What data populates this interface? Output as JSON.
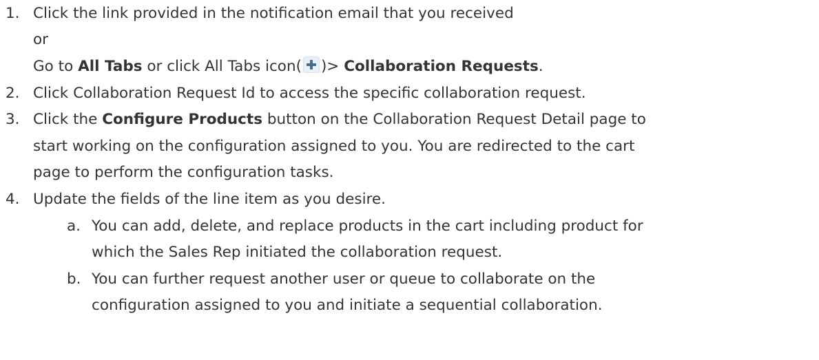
{
  "steps": [
    {
      "num": "1.",
      "l1": "Click the link provided in the notification email that you received",
      "or": "or",
      "goto_prefix": "Go to ",
      "all_tabs_bold": "All Tabs",
      "goto_mid": " or click All Tabs icon(",
      "icon": "plus-icon",
      "goto_after_icon": ")> ",
      "collab_bold": "Collaboration Requests",
      "goto_end": "."
    },
    {
      "num": "2.",
      "l1": "Click Collaboration Request Id to access the specific collaboration request."
    },
    {
      "num": "3.",
      "l1_prefix": "Click the ",
      "l1_bold": "Configure Products",
      "l1_rest": " button on the Collaboration Request Detail page to",
      "l2": "start working on the configuration assigned to you. You are redirected to the cart",
      "l3": "page to perform the configuration tasks."
    },
    {
      "num": "4.",
      "l1": "Update the fields of the line item as you desire.",
      "substeps": [
        {
          "letter": "a.",
          "l1": "You can add, delete, and replace products in the cart including product for",
          "l2": "which the Sales Rep initiated the collaboration request."
        },
        {
          "letter": "b.",
          "l1": "You can further request another user or queue to collaborate on the",
          "l2": "configuration assigned to you and initiate a sequential collaboration."
        }
      ]
    }
  ],
  "colors": {
    "text": "#333333",
    "icon_bg": "#e8f0f7",
    "icon_fg": "#4a6b8a"
  }
}
